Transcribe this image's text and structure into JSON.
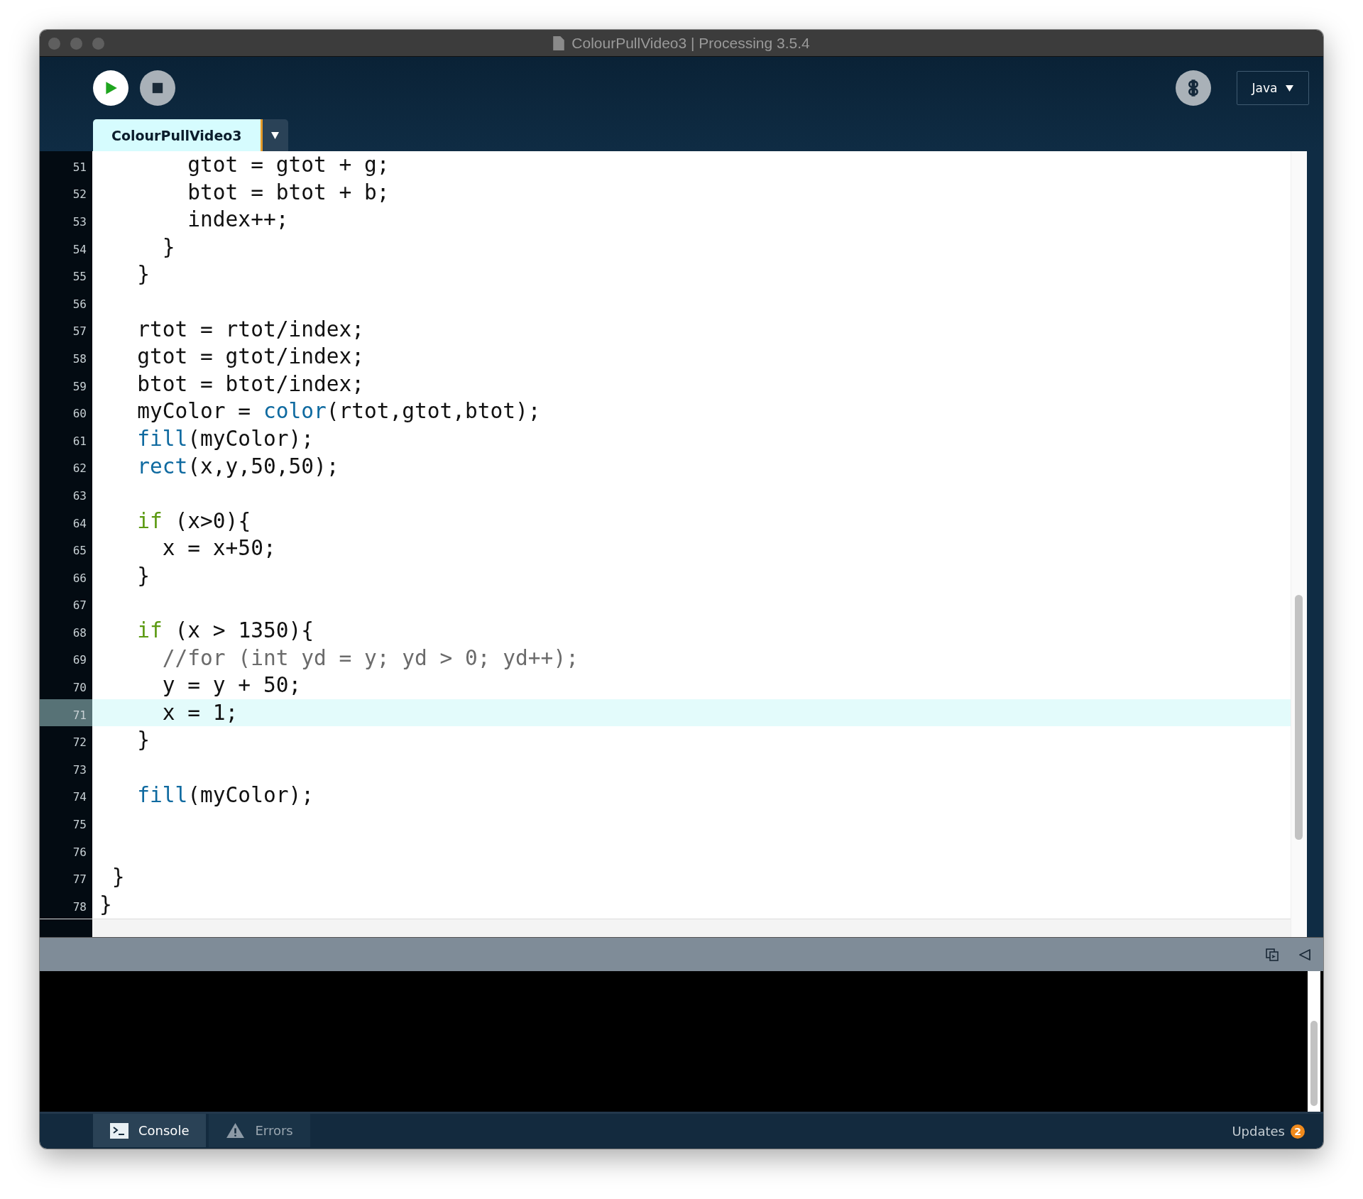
{
  "window": {
    "title": "ColourPullVideo3 | Processing 3.5.4"
  },
  "toolbar": {
    "mode": "Java"
  },
  "tabs": [
    {
      "label": "ColourPullVideo3",
      "selected": true
    }
  ],
  "editor": {
    "lines": [
      {
        "number": "51",
        "selected": false,
        "tokens": [
          {
            "kind": "plain",
            "text": "       gtot = gtot + g;"
          }
        ]
      },
      {
        "number": "52",
        "selected": false,
        "tokens": [
          {
            "kind": "plain",
            "text": "       btot = btot + b;"
          }
        ]
      },
      {
        "number": "53",
        "selected": false,
        "tokens": [
          {
            "kind": "plain",
            "text": "       index++;"
          }
        ]
      },
      {
        "number": "54",
        "selected": false,
        "tokens": [
          {
            "kind": "plain",
            "text": "     }"
          }
        ]
      },
      {
        "number": "55",
        "selected": false,
        "tokens": [
          {
            "kind": "plain",
            "text": "   }"
          }
        ]
      },
      {
        "number": "56",
        "selected": false
      },
      {
        "number": "57",
        "selected": false,
        "tokens": [
          {
            "kind": "plain",
            "text": "   rtot = rtot/index;"
          }
        ]
      },
      {
        "number": "58",
        "selected": false,
        "tokens": [
          {
            "kind": "plain",
            "text": "   gtot = gtot/index;"
          }
        ]
      },
      {
        "number": "59",
        "selected": false,
        "tokens": [
          {
            "kind": "plain",
            "text": "   btot = btot/index;"
          }
        ]
      },
      {
        "number": "60",
        "selected": false,
        "tokens": [
          {
            "kind": "plain",
            "text": "   myColor = "
          },
          {
            "kind": "function",
            "text": "color"
          },
          {
            "kind": "plain",
            "text": "(rtot,gtot,btot);"
          }
        ]
      },
      {
        "number": "61",
        "selected": false,
        "tokens": [
          {
            "kind": "function",
            "text": "   fill"
          },
          {
            "kind": "plain",
            "text": "(myColor);"
          }
        ]
      },
      {
        "number": "62",
        "selected": false,
        "tokens": [
          {
            "kind": "function",
            "text": "   rect"
          },
          {
            "kind": "plain",
            "text": "(x,y,50,50);"
          }
        ]
      },
      {
        "number": "63",
        "selected": false
      },
      {
        "number": "64",
        "selected": false,
        "tokens": [
          {
            "kind": "keyword",
            "text": "   if"
          },
          {
            "kind": "plain",
            "text": " (x>0){"
          }
        ]
      },
      {
        "number": "65",
        "selected": false,
        "tokens": [
          {
            "kind": "plain",
            "text": "     x = x+50;"
          }
        ]
      },
      {
        "number": "66",
        "selected": false,
        "tokens": [
          {
            "kind": "plain",
            "text": "   }"
          }
        ]
      },
      {
        "number": "67",
        "selected": false
      },
      {
        "number": "68",
        "selected": false,
        "tokens": [
          {
            "kind": "keyword",
            "text": "   if"
          },
          {
            "kind": "plain",
            "text": " (x > 1350){"
          }
        ]
      },
      {
        "number": "69",
        "selected": false,
        "tokens": [
          {
            "kind": "comment",
            "text": "     //for (int yd = y; yd > 0; yd++);"
          }
        ]
      },
      {
        "number": "70",
        "selected": false,
        "tokens": [
          {
            "kind": "plain",
            "text": "     y = y + 50;"
          }
        ]
      },
      {
        "number": "71",
        "selected": true,
        "tokens": [
          {
            "kind": "plain",
            "text": "     x = 1;"
          }
        ]
      },
      {
        "number": "72",
        "selected": false,
        "tokens": [
          {
            "kind": "plain",
            "text": "   }"
          }
        ]
      },
      {
        "number": "73",
        "selected": false
      },
      {
        "number": "74",
        "selected": false,
        "tokens": [
          {
            "kind": "function",
            "text": "   fill"
          },
          {
            "kind": "plain",
            "text": "(myColor);"
          }
        ]
      },
      {
        "number": "75",
        "selected": false
      },
      {
        "number": "76",
        "selected": false
      },
      {
        "number": "77",
        "selected": false,
        "tokens": [
          {
            "kind": "plain",
            "text": " }"
          }
        ]
      },
      {
        "number": "78",
        "selected": false,
        "tokens": [
          {
            "kind": "plain",
            "text": "}"
          }
        ]
      }
    ]
  },
  "bottom_tabs": [
    {
      "label": "Console",
      "selected": true,
      "kind": "console"
    },
    {
      "label": "Errors",
      "selected": false,
      "kind": "errors"
    }
  ],
  "updates": {
    "label": "Updates",
    "count": "2"
  }
}
